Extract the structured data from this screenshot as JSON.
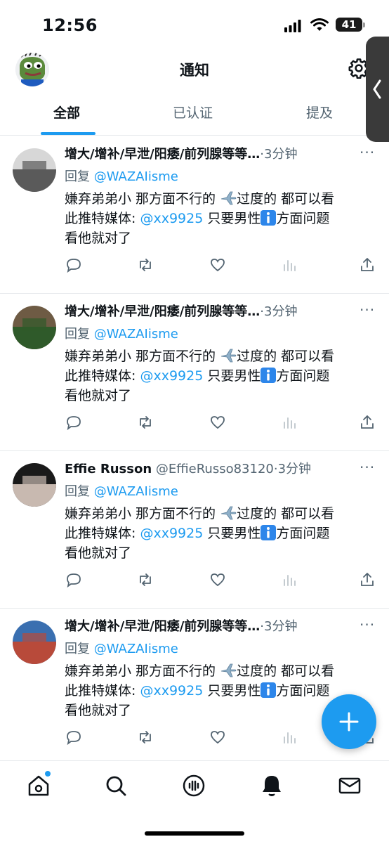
{
  "status_bar": {
    "time": "12:56",
    "battery": "41"
  },
  "header": {
    "title": "通知",
    "tabs": [
      {
        "label": "全部",
        "active": true
      },
      {
        "label": "已认证",
        "active": false
      },
      {
        "label": "提及",
        "active": false
      }
    ]
  },
  "notifications": [
    {
      "name": "增大/增补/早泄/阳痿/前列腺等等…",
      "handle": "",
      "time": "·3分钟",
      "reply_prefix": "回复",
      "reply_to": "@WAZAIisme",
      "line1_a": "嫌弃弟弟小 那方面不行的 ",
      "line1_b": "过度的  都可以看",
      "line2_a": "此推特媒体: ",
      "mention": "@xx9925",
      "line2_b": "  只要男性",
      "line2_c": "方面问题",
      "line3": "看他就对了",
      "more": "···"
    },
    {
      "name": "增大/增补/早泄/阳痿/前列腺等等…",
      "handle": "",
      "time": "·3分钟",
      "reply_prefix": "回复",
      "reply_to": "@WAZAIisme",
      "line1_a": "嫌弃弟弟小 那方面不行的 ",
      "line1_b": "过度的  都可以看",
      "line2_a": "此推特媒体: ",
      "mention": "@xx9925",
      "line2_b": "  只要男性",
      "line2_c": "方面问题",
      "line3": "看他就对了",
      "more": "···"
    },
    {
      "name": "Effie Russon",
      "handle": " @EffieRusso83120",
      "time": "·3分钟",
      "reply_prefix": "回复",
      "reply_to": "@WAZAIisme",
      "line1_a": "嫌弃弟弟小 那方面不行的 ",
      "line1_b": "过度的  都可以看",
      "line2_a": "此推特媒体: ",
      "mention": "@xx9925",
      "line2_b": "  只要男性",
      "line2_c": "方面问题",
      "line3": "看他就对了",
      "more": "···"
    },
    {
      "name": "增大/增补/早泄/阳痿/前列腺等等…",
      "handle": "",
      "time": "·3分钟",
      "reply_prefix": "回复",
      "reply_to": "@WAZAIisme",
      "line1_a": "嫌弃弟弟小 那方面不行的 ",
      "line1_b": "过度的  都可以看",
      "line2_a": "此推特媒体: ",
      "mention": "@xx9925",
      "line2_b": "  只要男性",
      "line2_c": "方面问题",
      "line3": "看他就对了",
      "more": "···"
    }
  ],
  "icons": {
    "actions": [
      "reply-icon",
      "retweet-icon",
      "like-icon",
      "views-icon",
      "share-icon"
    ],
    "nav": [
      "home-icon",
      "search-icon",
      "spaces-icon",
      "notifications-icon",
      "messages-icon"
    ]
  },
  "colors": {
    "accent": "#1d9bf0",
    "text": "#0f1419",
    "secondary": "#536471"
  }
}
